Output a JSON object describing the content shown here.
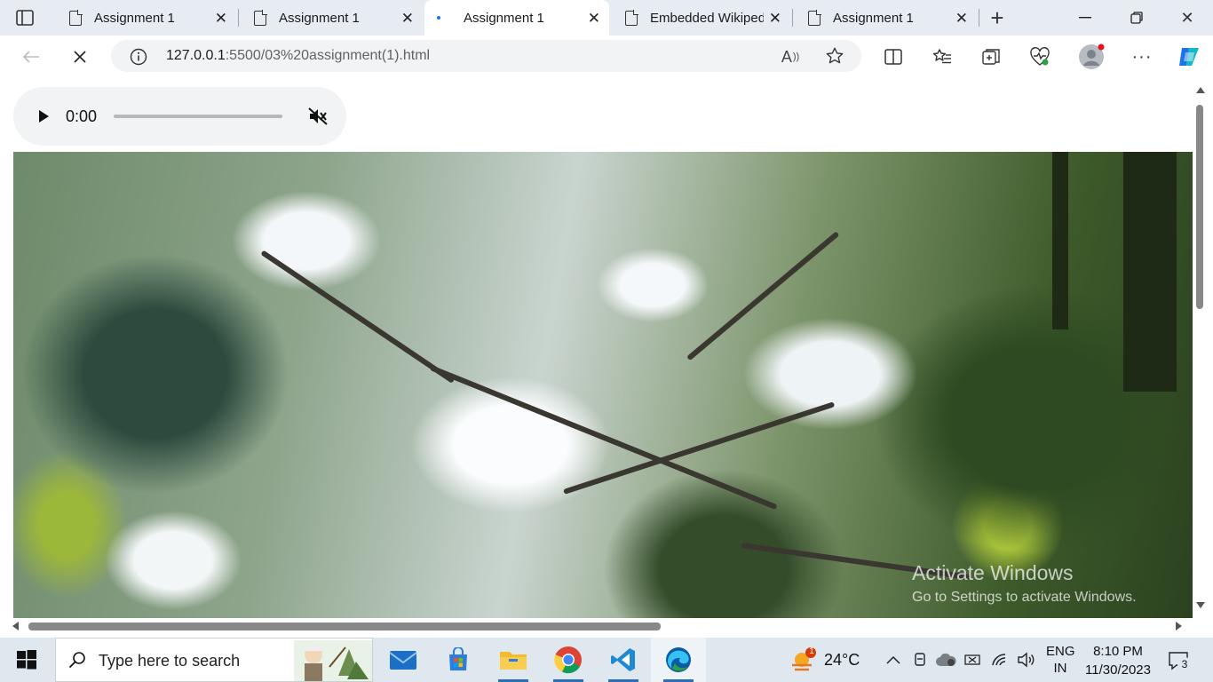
{
  "tabs": [
    {
      "title": "Assignment 1"
    },
    {
      "title": "Assignment 1"
    },
    {
      "title": "Assignment 1",
      "active": true
    },
    {
      "title": "Embedded Wikiped"
    },
    {
      "title": "Assignment 1"
    }
  ],
  "address": {
    "host": "127.0.0.1",
    "rest": ":5500/03%20assignment(1).html"
  },
  "audio": {
    "time": "0:00",
    "progress": 0,
    "muted": true
  },
  "watermark": {
    "line1": "Activate Windows",
    "line2": "Go to Settings to activate Windows."
  },
  "taskbar": {
    "search_placeholder": "Type here to search",
    "weather": {
      "temp": "24°C",
      "badge": "1"
    },
    "lang": {
      "line1": "ENG",
      "line2": "IN"
    },
    "clock": {
      "time": "8:10 PM",
      "date": "11/30/2023"
    },
    "notifications": "3"
  },
  "colors": {
    "accent": "#1a73e8",
    "edge_blue": "#0c59a4",
    "tabbar": "#e6ecf2",
    "taskbar": "#dfe8ef"
  }
}
